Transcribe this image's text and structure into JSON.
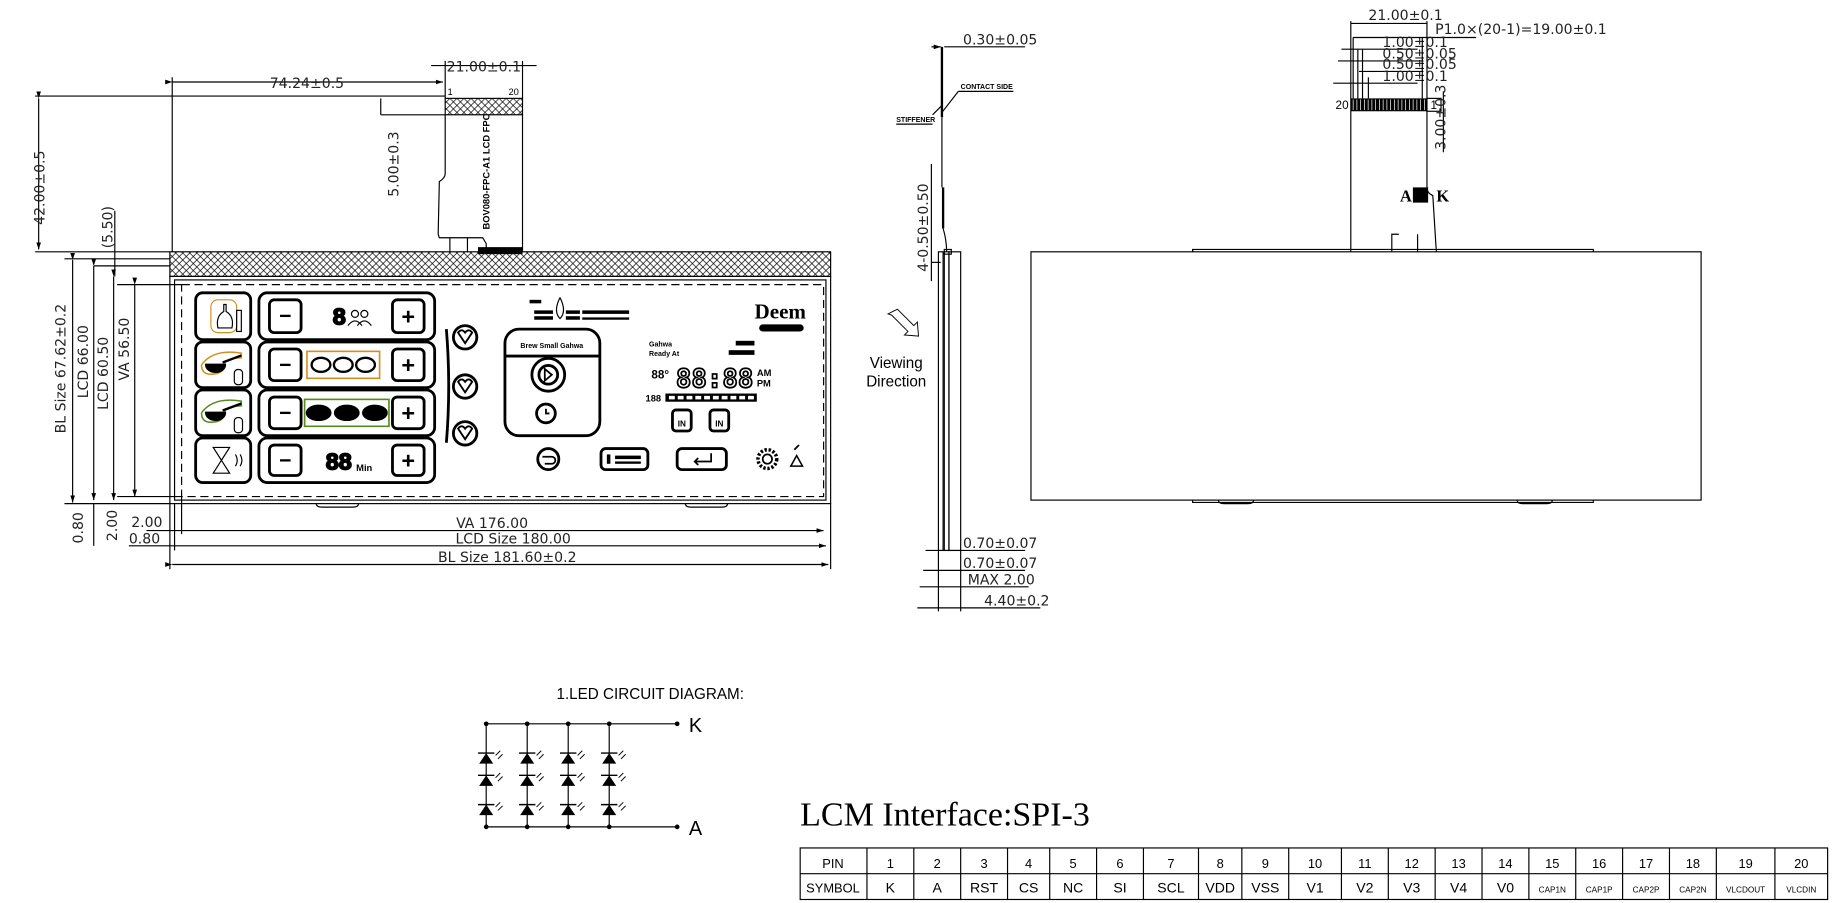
{
  "front_view": {
    "fpc_width": "21.00±0.1",
    "fpc_offset": "74.24±0.5",
    "total_height": "42.00±0.5",
    "fpc_pin_length": "5.00±0.3",
    "gap": "(5.50)",
    "pin_first": "1",
    "pin_last": "20",
    "fpc_label": "BOV080-FPC-A1   LCD FPC",
    "bl_height": "BL Size 67.62±0.2",
    "lcd_height": "LCD 66.00",
    "lcd_inner_height": "LCD 60.50",
    "va_height": "VA 56.50",
    "bottom_gap_bl": "0.80",
    "bottom_gap_va": "2.00",
    "left_gap_va": "2.00",
    "left_gap_bl": "0.80",
    "va_width": "VA 176.00",
    "lcd_width": "LCD Size 180.00",
    "bl_width": "BL Size 181.60±0.2"
  },
  "lcd_segments": {
    "digit_single": "8",
    "digits_minutes": "88",
    "minutes_unit": "Min",
    "clock": "88:88",
    "am": "AM",
    "pm": "PM",
    "temp": "88°",
    "counter": "188",
    "label_gahwa": "Gahwa",
    "label_ready": "Ready At",
    "brew_label": "Brew Small Gahwa",
    "logo": "Deem",
    "button_in_1": "IN",
    "button_in_2": "IN",
    "minus": "−",
    "plus": "+",
    "highlight_orange": "#d4901e",
    "highlight_green": "#5a8a1e"
  },
  "side_view": {
    "fpc_thickness": "0.30±0.05",
    "contact_side": "CONTACT SIDE",
    "stiffener": "STIFFENER",
    "tab_dim": "4-0.50±0.50",
    "viewing_1": "Viewing",
    "viewing_2": "Direction",
    "dim_1": "0.70±0.07",
    "dim_2": "0.70±0.07",
    "dim_3": "MAX  2.00",
    "dim_4": "4.40±0.2"
  },
  "back_view": {
    "fpc_width": "21.00±0.1",
    "pitch": "P1.0×(20-1)=19.00±0.1",
    "dim_a": "1.00±0.1",
    "dim_b": "0.50±0.05",
    "dim_c": "0.50±0.05",
    "dim_d": "1.00±0.1",
    "stiffener_len": "3.00±0.3",
    "pin_left": "20",
    "pin_right": "1",
    "anode": "A",
    "cathode": "K"
  },
  "led_circuit": {
    "title": "1.LED  CIRCUIT  DIAGRAM:",
    "top_terminal": "K",
    "bottom_terminal": "A",
    "strings": 4,
    "leds_per_string": 3
  },
  "interface": {
    "title": "LCM Interface:SPI-3",
    "pin_header": "PIN",
    "symbol_header": "SYMBOL",
    "pins": [
      {
        "pin": "1",
        "symbol": "K"
      },
      {
        "pin": "2",
        "symbol": "A"
      },
      {
        "pin": "3",
        "symbol": "RST"
      },
      {
        "pin": "4",
        "symbol": "CS"
      },
      {
        "pin": "5",
        "symbol": "NC"
      },
      {
        "pin": "6",
        "symbol": "SI"
      },
      {
        "pin": "7",
        "symbol": "SCL"
      },
      {
        "pin": "8",
        "symbol": "VDD"
      },
      {
        "pin": "9",
        "symbol": "VSS"
      },
      {
        "pin": "10",
        "symbol": "V1"
      },
      {
        "pin": "11",
        "symbol": "V2"
      },
      {
        "pin": "12",
        "symbol": "V3"
      },
      {
        "pin": "13",
        "symbol": "V4"
      },
      {
        "pin": "14",
        "symbol": "V0"
      },
      {
        "pin": "15",
        "symbol": "CAP1N"
      },
      {
        "pin": "16",
        "symbol": "CAP1P"
      },
      {
        "pin": "17",
        "symbol": "CAP2P"
      },
      {
        "pin": "18",
        "symbol": "CAP2N"
      },
      {
        "pin": "19",
        "symbol": "VLCDOUT"
      },
      {
        "pin": "20",
        "symbol": "VLCDIN"
      }
    ]
  }
}
